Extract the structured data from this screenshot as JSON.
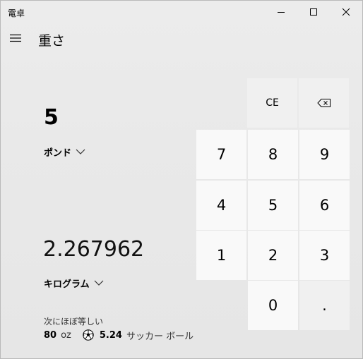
{
  "window": {
    "title": "電卓",
    "controls": [
      "minimize-icon",
      "maximize-icon",
      "close-icon"
    ]
  },
  "header": {
    "menu_icon": "hamburger-icon",
    "mode_title": "重さ"
  },
  "converter": {
    "input_value": "5",
    "input_unit": "ポンド",
    "output_value": "2.267962",
    "output_unit": "キログラム",
    "approx_label": "次にほぼ等しい",
    "approx": [
      {
        "value": "80",
        "unit": "oz",
        "icon": null
      },
      {
        "value": "5.24",
        "unit": "サッカー ボール",
        "icon": "soccer-ball-icon"
      }
    ]
  },
  "keypad": {
    "clear_entry": "CE",
    "backspace_icon": "backspace-icon",
    "digits": [
      "7",
      "8",
      "9",
      "4",
      "5",
      "6",
      "1",
      "2",
      "3",
      "0"
    ],
    "decimal": "."
  }
}
